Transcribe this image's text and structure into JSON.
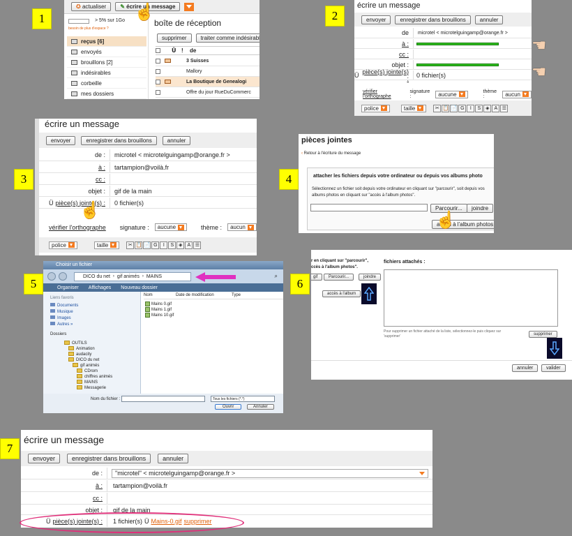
{
  "steps": [
    "1",
    "2",
    "3",
    "4",
    "5",
    "6",
    "7"
  ],
  "p1": {
    "refresh": "actualiser",
    "write": "écrire un message",
    "quota": "> 5% sur 1Go",
    "quota_hint": "besoin de plus d'espace ?",
    "folders": [
      {
        "label": "reçus [6]",
        "active": true
      },
      {
        "label": "envoyés",
        "active": false
      },
      {
        "label": "brouillons [2]",
        "active": false
      },
      {
        "label": "indésirables",
        "active": false
      },
      {
        "label": "corbeille",
        "active": false
      },
      {
        "label": "mes dossiers",
        "active": false
      }
    ],
    "inbox_title": "boîte de réception",
    "delete": "supprimer",
    "spam": "traiter comme indésirable",
    "col_from": "de",
    "col_attach": "Ü",
    "col_prio": "!",
    "mails": [
      "3 Suisses",
      "Mallory",
      "La Boutique de Genealogi",
      "Offre du jour RueDuCommerc"
    ]
  },
  "p2": {
    "title": "écrire un message",
    "send": "envoyer",
    "draft": "enregistrer dans brouillons",
    "cancel": "annuler",
    "from_label": "de",
    "from_value": "microtel < microtelguingamp@orange.fr >",
    "to_label": "à :",
    "cc_label": "cc :",
    "subject_label": "objet :",
    "attach_label": "pièce(s) jointe(s) :",
    "attach_value": "0 fichier(s)",
    "attach_glyph": "Ü",
    "spell": "vérifier l'orthographe",
    "signature_label": "signature :",
    "signature_value": "aucune",
    "theme_label": "thème :",
    "theme_value": "aucun",
    "font": "police",
    "size": "taille",
    "tools": [
      "✂",
      "📋",
      "📄",
      "G",
      "I",
      "S",
      "◈",
      "A",
      "☰"
    ]
  },
  "p3": {
    "title": "écrire un message",
    "send": "envoyer",
    "draft": "enregistrer dans brouillons",
    "cancel": "annuler",
    "from_label": "de :",
    "from_value": "microtel < microtelguingamp@orange.fr >",
    "to_label": "à :",
    "to_value": "tartampion@voilà.fr",
    "cc_label": "cc :",
    "subject_label": "objet :",
    "subject_value": "gif de la main",
    "attach_label": "pièce(s) jointe(s) :",
    "attach_value": "0 fichier(s)",
    "attach_glyph": "Ü",
    "spell": "vérifier l'orthographe",
    "signature_label": "signature :",
    "signature_value": "aucune",
    "theme_label": "thème :",
    "theme_value": "aucun",
    "font": "police",
    "size": "taille",
    "tools": [
      "✂",
      "📋",
      "📄",
      "G",
      "I",
      "S",
      "◈",
      "A",
      "☰"
    ]
  },
  "p4": {
    "title": "pièces jointes",
    "back": "Retour à l'écriture du message",
    "section": "attacher les fichiers depuis votre ordinateur ou depuis vos albums photo",
    "instructions": "Sélectionnez un fichier soit depuis votre ordinateur en cliquant sur \"parcourir\", soit depuis vos albums photos en cliquant sur \"accès à l'album photos\".",
    "browse": "Parcourir...",
    "join": "joindre",
    "album": "accès à l'album photos"
  },
  "p5": {
    "window_title": "Choisir un fichier",
    "path": [
      "DICO du net",
      "gif animés",
      "MAINS"
    ],
    "organize": "Organiser",
    "views": "Affichages",
    "new_folder": "Nouveau dossier",
    "favorites_title": "Liens favoris",
    "favorites": [
      "Documents",
      "Musique",
      "Images",
      "Autres »"
    ],
    "folders_title": "Dossiers",
    "tree": [
      "OUTILS",
      "Animation",
      "audacity",
      "DICO du net",
      "gif animés",
      "CDrom",
      "chiffres animés",
      "MAINS",
      "Messagerie"
    ],
    "col_name": "Nom",
    "col_date": "Date de modification",
    "col_type": "Type",
    "files": [
      "Mains 0.gif",
      "Mains 1.gif",
      "Mains 10.gif"
    ],
    "filename_label": "Nom du fichier :",
    "filetype": "Tous les fichiers (*.*)",
    "open": "Ouvrir",
    "cancel": "Annuler"
  },
  "p6": {
    "hint_line1": "r en cliquant sur \"parcourir\",",
    "hint_line2": "ccès à l'album photos\".",
    "gif": "gif",
    "browse": "Parcourir...",
    "join": "joindre",
    "album": "accès à l'album",
    "attached_title": "fichiers attachés :",
    "remove_hint": "Pour supprimer un fichier attaché de la liste, sélectionnez-le puis cliquez sur 'supprimer'",
    "remove": "supprimer",
    "cancel": "annuler",
    "validate": "valider"
  },
  "p7": {
    "title": "écrire un message",
    "send": "envoyer",
    "draft": "enregistrer dans brouillons",
    "cancel": "annuler",
    "from_label": "de :",
    "from_value": "\"microtel\" < microtelguingamp@orange.fr >",
    "to_label": "à :",
    "to_value": "tartampion@voilà.fr",
    "cc_label": "cc :",
    "subject_label": "objet :",
    "subject_value": "gif de la main",
    "attach_label": "pièce(s) jointe(s) :",
    "attach_count": "1 fichier(s)",
    "attach_file": "Mains-0.gif",
    "attach_remove": "supprimer",
    "attach_glyph": "Ü"
  },
  "colors": {
    "highlight_yellow": "#ffff00",
    "accent_orange": "#e0600a",
    "pink_arrow": "#e030c0",
    "oval": "#e0307a",
    "blue_arrow_box": "#0a0a2a"
  }
}
